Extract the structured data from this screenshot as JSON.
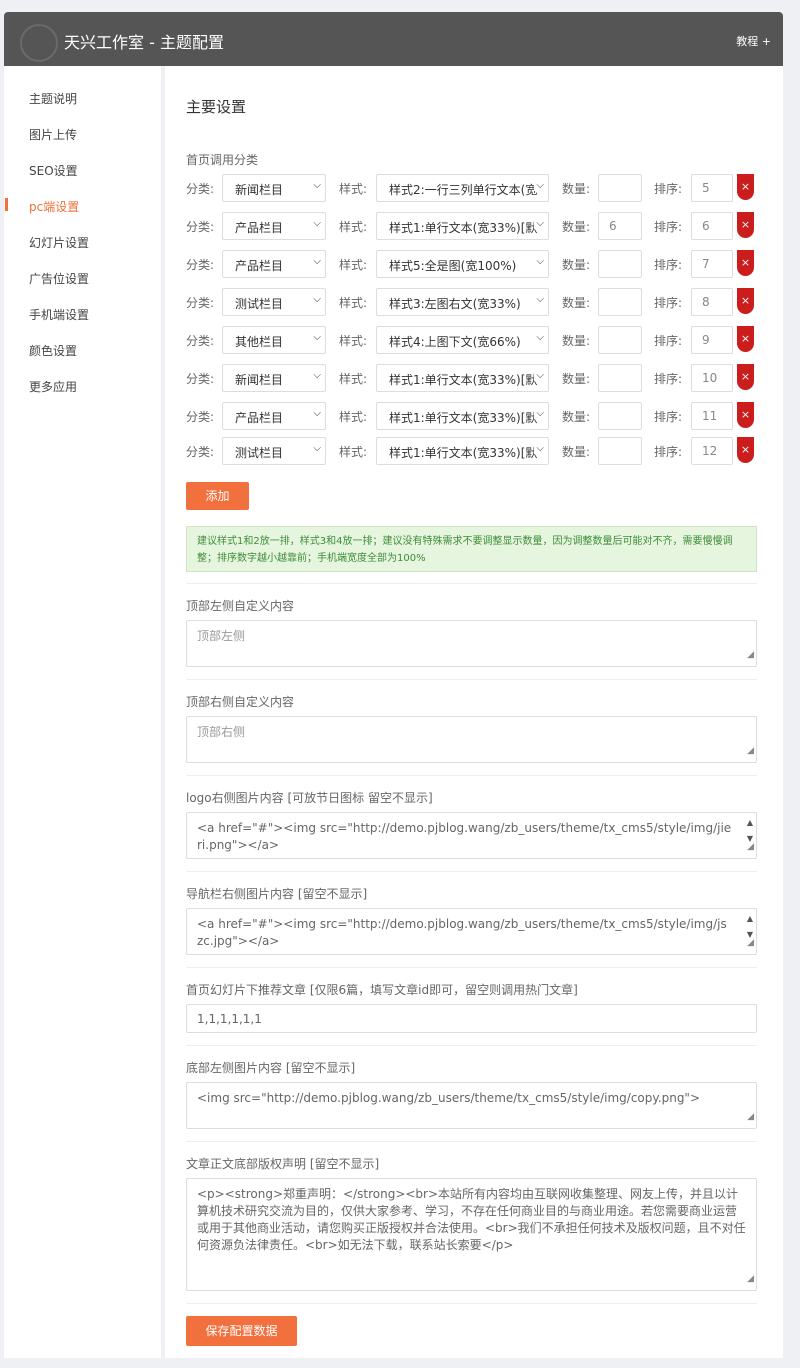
{
  "header": {
    "title": "天兴工作室 - 主题配置",
    "tutorial": "教程 +"
  },
  "sidebar": {
    "items": [
      {
        "label": "主题说明",
        "active": false
      },
      {
        "label": "图片上传",
        "active": false
      },
      {
        "label": "SEO设置",
        "active": false
      },
      {
        "label": "pc端设置",
        "active": true
      },
      {
        "label": "幻灯片设置",
        "active": false
      },
      {
        "label": "广告位设置",
        "active": false
      },
      {
        "label": "手机端设置",
        "active": false
      },
      {
        "label": "颜色设置",
        "active": false
      },
      {
        "label": "更多应用",
        "active": false
      }
    ]
  },
  "main": {
    "title": "主要设置",
    "homepage_categories_label": "首页调用分类",
    "row_labels": {
      "category": "分类:",
      "style": "样式:",
      "count": "数量:",
      "order": "排序:"
    },
    "delete_icon": "×",
    "rows": [
      {
        "category": "新闻栏目",
        "style": "样式2:一行三列单行文本(宽",
        "count": "",
        "order": "5"
      },
      {
        "category": "产品栏目",
        "style": "样式1:单行文本(宽33%)[默",
        "count": "6",
        "order": "6"
      },
      {
        "category": "产品栏目",
        "style": "样式5:全是图(宽100%)",
        "count": "",
        "order": "7"
      },
      {
        "category": "测试栏目",
        "style": "样式3:左图右文(宽33%)",
        "count": "",
        "order": "8"
      },
      {
        "category": "其他栏目",
        "style": "样式4:上图下文(宽66%)",
        "count": "",
        "order": "9"
      },
      {
        "category": "新闻栏目",
        "style": "样式1:单行文本(宽33%)[默",
        "count": "",
        "order": "10"
      },
      {
        "category": "产品栏目",
        "style": "样式1:单行文本(宽33%)[默",
        "count": "",
        "order": "11"
      },
      {
        "category": "测试栏目",
        "style": "样式1:单行文本(宽33%)[默",
        "count": "",
        "order": "12"
      }
    ],
    "add_button": "添加",
    "hint": "建议样式1和2放一排，样式3和4放一排；建议没有特殊需求不要调整显示数量，因为调整数量后可能对不齐，需要慢慢调整；排序数字越小越靠前；手机端宽度全部为100%",
    "fields": [
      {
        "label": "顶部左侧自定义内容",
        "value": "",
        "placeholder": "顶部左侧"
      },
      {
        "label": "顶部右侧自定义内容",
        "value": "",
        "placeholder": "顶部右侧"
      },
      {
        "label": "logo右侧图片内容 [可放节日图标 留空不显示]",
        "value": "<a href=\"#\"><img src=\"http://demo.pjblog.wang/zb_users/theme/tx_cms5/style/img/jieri.png\"></a>",
        "placeholder": ""
      },
      {
        "label": "导航栏右侧图片内容 [留空不显示]",
        "value": "<a href=\"#\"><img src=\"http://demo.pjblog.wang/zb_users/theme/tx_cms5/style/img/jszc.jpg\"></a>",
        "placeholder": ""
      },
      {
        "label": "首页幻灯片下推荐文章 [仅限6篇，填写文章id即可，留空则调用热门文章]",
        "value": "1,1,1,1,1,1",
        "placeholder": ""
      },
      {
        "label": "底部左侧图片内容 [留空不显示]",
        "value": "<img src=\"http://demo.pjblog.wang/zb_users/theme/tx_cms5/style/img/copy.png\">",
        "placeholder": ""
      },
      {
        "label": "文章正文底部版权声明 [留空不显示]",
        "value": "<p><strong>郑重声明：</strong><br>本站所有内容均由互联网收集整理、网友上传，并且以计算机技术研究交流为目的，仅供大家参考、学习，不存在任何商业目的与商业用途。若您需要商业运营或用于其他商业活动，请您购买正版授权并合法使用。<br>我们不承担任何技术及版权问题，且不对任何资源负法律责任。<br>如无法下载，联系站长索要</p>",
        "placeholder": ""
      }
    ],
    "save_button": "保存配置数据"
  },
  "colors": {
    "accent": "#f2703e",
    "header_bg": "#555555",
    "delete": "#cc1d1d",
    "hint_bg": "#e6f5de"
  }
}
